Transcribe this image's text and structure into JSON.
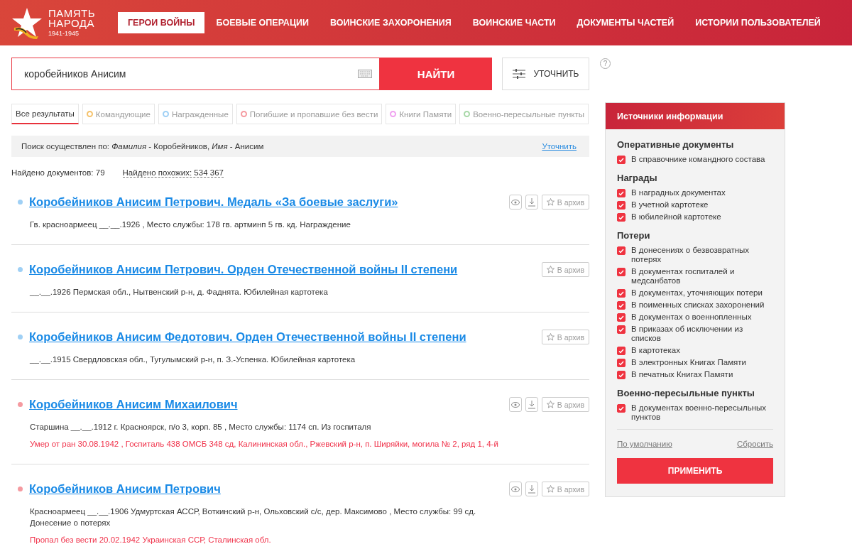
{
  "logo": {
    "line_1": "ПАМЯТЬ",
    "line_2": "НАРОДА",
    "years": "1941-1945"
  },
  "nav": [
    {
      "label": "ГЕРОИ ВОЙНЫ",
      "selected": true
    },
    {
      "label": "БОЕВЫЕ ОПЕРАЦИИ",
      "selected": false
    },
    {
      "label": "ВОИНСКИЕ ЗАХОРОНЕНИЯ",
      "selected": false
    },
    {
      "label": "ВОИНСКИЕ ЧАСТИ",
      "selected": false
    },
    {
      "label": "ДОКУМЕНТЫ ЧАСТЕЙ",
      "selected": false
    },
    {
      "label": "ИСТОРИИ ПОЛЬЗОВАТЕЛЕЙ",
      "selected": false
    }
  ],
  "search": {
    "value": "коробейников Анисим",
    "button": "НАЙТИ",
    "refine_button": "УТОЧНИТЬ",
    "help": "?"
  },
  "filters": [
    {
      "label": "Все результаты",
      "selected": true
    },
    {
      "label": "Командующие",
      "selected": false,
      "color": "#f5c26b"
    },
    {
      "label": "Награжденные",
      "selected": false,
      "color": "#9fd0f5"
    },
    {
      "label": "Погибшие и пропавшие без вести",
      "selected": false,
      "color": "#f59aa0"
    },
    {
      "label": "Книги Памяти",
      "selected": false,
      "color": "#f0a0f0"
    },
    {
      "label": "Военно-пересыльные пункты",
      "selected": false,
      "color": "#a8d8a8"
    }
  ],
  "query": {
    "text": "Поиск осуществлен по: *Фамилия* - Коробейников, *Имя* - Анисим",
    "link": "Уточнить"
  },
  "counts": {
    "found": "Найдено документов: 79",
    "similar": "Найдено похожих: 534 367"
  },
  "results": [
    {
      "color": "#9fd0f5",
      "title": "Коробейников Анисим Петрович. Медаль «За боевые заслуги»",
      "view": true,
      "download": true,
      "archive": "В архив",
      "lines": [
        {
          "kind": "info",
          "text": "Гв. красноармеец __.__.1926 , Место службы: 178 гв. артминп 5 гв. кд. Награждение"
        }
      ]
    },
    {
      "color": "#9fd0f5",
      "title": "Коробейников Анисим Петрович. Орден Отечественной войны II степени",
      "view": false,
      "download": false,
      "archive": "В архив",
      "lines": [
        {
          "kind": "info",
          "text": "__.__.1926 Пермская обл., Нытвенский р-н, д. Фаднята. Юбилейная картотека"
        }
      ]
    },
    {
      "color": "#9fd0f5",
      "title": "Коробейников Анисим Федотович. Орден Отечественной войны II степени",
      "view": false,
      "download": false,
      "archive": "В архив",
      "lines": [
        {
          "kind": "info",
          "text": "__.__.1915 Свердловская обл., Тугулымский р-н, п. З.-Успенка. Юбилейная картотека"
        }
      ]
    },
    {
      "color": "#f59aa0",
      "title": "Коробейников Анисим Михаилович",
      "view": true,
      "download": true,
      "archive": "В архив",
      "lines": [
        {
          "kind": "info",
          "text": "Старшина __.__.1912 г. Красноярск, п/о 3, корп. 85 , Место службы: 1174 сп. Из госпиталя"
        },
        {
          "kind": "loss",
          "text": "Умер от ран 30.08.1942 , Госпиталь 438 ОМСБ 348 сд, Калининская обл., Ржевский р-н, п. Ширяйки, могила № 2, ряд 1, 4-й"
        }
      ]
    },
    {
      "color": "#f59aa0",
      "title": "Коробейников Анисим Петрович",
      "view": true,
      "download": true,
      "archive": "В архив",
      "lines": [
        {
          "kind": "info",
          "text": "Красноармеец __.__.1906 Удмуртская АССР, Воткинский р-н, Ольховский с/с, дер. Максимово , Место службы: 99 сд.\nДонесение о потерях"
        },
        {
          "kind": "loss",
          "text": "Пропал без вести 20.02.1942 Украинская ССР, Сталинская обл."
        }
      ]
    }
  ],
  "sources": {
    "title": "Источники информации",
    "groups": [
      {
        "title": "Оперативные документы",
        "items": [
          {
            "label": "В справочнике командного состава",
            "checked": true
          }
        ]
      },
      {
        "title": "Награды",
        "items": [
          {
            "label": "В наградных документах",
            "checked": true
          },
          {
            "label": "В учетной картотеке",
            "checked": true
          },
          {
            "label": "В юбилейной картотеке",
            "checked": true
          }
        ]
      },
      {
        "title": "Потери",
        "items": [
          {
            "label": "В донесениях о безвозвратных потерях",
            "checked": true
          },
          {
            "label": "В документах госпиталей и медсанбатов",
            "checked": true
          },
          {
            "label": "В документах, уточняющих потери",
            "checked": true
          },
          {
            "label": "В поименных списках захоронений",
            "checked": true
          },
          {
            "label": "В документах о военнопленных",
            "checked": true
          },
          {
            "label": "В приказах об исключении из списков",
            "checked": true
          },
          {
            "label": "В картотеках",
            "checked": true
          },
          {
            "label": "В электронных Книгах Памяти",
            "checked": true
          },
          {
            "label": "В печатных Книгах Памяти",
            "checked": true
          }
        ]
      },
      {
        "title": "Военно-пересыльные пункты",
        "items": [
          {
            "label": "В документах военно-пересыльных пунктов",
            "checked": true
          }
        ]
      }
    ],
    "default_link": "По умолчанию",
    "reset_link": "Сбросить",
    "apply_button": "ПРИМЕНИТЬ"
  }
}
